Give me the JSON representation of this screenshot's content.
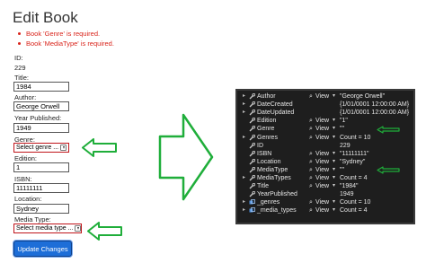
{
  "page": {
    "title": "Edit Book",
    "errors": [
      "Book 'Genre' is required.",
      "Book 'MediaType' is required."
    ]
  },
  "form": {
    "id_label": "ID:",
    "id_value": "229",
    "title_label": "Title:",
    "title_value": "1984",
    "author_label": "Author:",
    "author_value": "George Orwell",
    "year_label": "Year Published:",
    "year_value": "1949",
    "genre_label": "Genre:",
    "genre_value": "Select genre ...",
    "edition_label": "Edition:",
    "edition_value": "1",
    "isbn_label": "ISBN:",
    "isbn_value": "11111111",
    "location_label": "Location:",
    "location_value": "Sydney",
    "mediatype_label": "Media Type:",
    "mediatype_value": "Select media type ...",
    "submit_label": "Update Changes"
  },
  "debugger": {
    "view_label": "View",
    "rows": [
      {
        "name": "Author",
        "value": "\"George Orwell\"",
        "icon": "wrench-icon",
        "expandable": true,
        "has_view": true
      },
      {
        "name": "DateCreated",
        "value": "{1/01/0001 12:00:00 AM}",
        "icon": "wrench-icon",
        "expandable": true,
        "has_view": false
      },
      {
        "name": "DateUpdated",
        "value": "{1/01/0001 12:00:00 AM}",
        "icon": "wrench-icon",
        "expandable": true,
        "has_view": false
      },
      {
        "name": "Edition",
        "value": "\"1\"",
        "icon": "wrench-icon",
        "expandable": false,
        "has_view": true
      },
      {
        "name": "Genre",
        "value": "\"\"",
        "icon": "wrench-icon",
        "expandable": false,
        "has_view": true
      },
      {
        "name": "Genres",
        "value": "Count = 10",
        "icon": "wrench-icon",
        "expandable": true,
        "has_view": true
      },
      {
        "name": "ID",
        "value": "229",
        "icon": "wrench-icon",
        "expandable": false,
        "has_view": false
      },
      {
        "name": "ISBN",
        "value": "\"11111111\"",
        "icon": "wrench-icon",
        "expandable": false,
        "has_view": true
      },
      {
        "name": "Location",
        "value": "\"Sydney\"",
        "icon": "wrench-icon",
        "expandable": false,
        "has_view": true
      },
      {
        "name": "MediaType",
        "value": "\"\"",
        "icon": "wrench-icon",
        "expandable": false,
        "has_view": true
      },
      {
        "name": "MediaTypes",
        "value": "Count = 4",
        "icon": "wrench-icon",
        "expandable": true,
        "has_view": true
      },
      {
        "name": "Title",
        "value": "\"1984\"",
        "icon": "wrench-icon",
        "expandable": false,
        "has_view": true
      },
      {
        "name": "YearPublished",
        "value": "1949",
        "icon": "wrench-icon",
        "expandable": false,
        "has_view": false
      },
      {
        "name": "_genres",
        "value": "Count = 10",
        "icon": "field-icon",
        "expandable": true,
        "has_view": true
      },
      {
        "name": "_media_types",
        "value": "Count = 4",
        "icon": "field-icon",
        "expandable": true,
        "has_view": true
      }
    ]
  },
  "colors": {
    "error": "#d9241b",
    "select_border": "#c0151b",
    "button": "#1d6ed8",
    "arrow": "#1fae3a",
    "debugger_bg": "#1e1e1e"
  }
}
